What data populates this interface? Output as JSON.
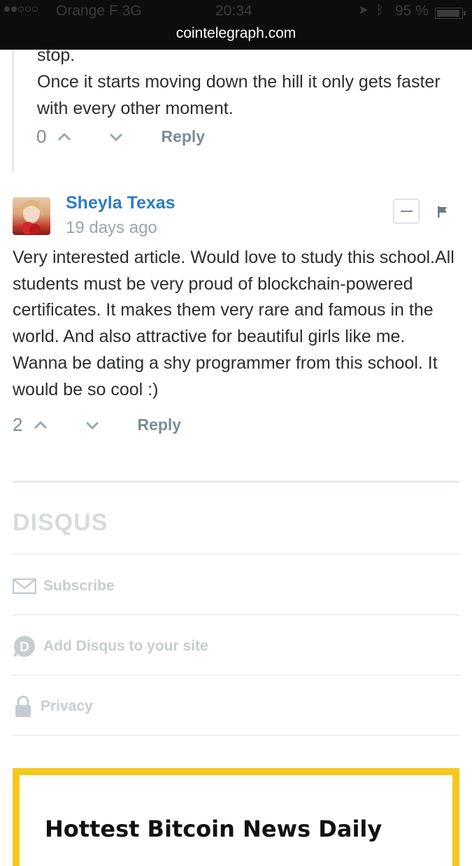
{
  "status_bar": {
    "carrier": "Orange F  3G",
    "time": "20:34",
    "battery": "95 %",
    "battery_level": 0.95
  },
  "browser": {
    "url": "cointelegraph.com"
  },
  "reply": {
    "text_cut": "stop.",
    "text": "Once it starts moving down the hill it only gets faster with every other moment.",
    "votes": "0",
    "reply_label": "Reply"
  },
  "comment": {
    "author": "Sheyla Texas",
    "time_ago": "19 days ago",
    "text": "Very interested article. Would love to study this school.All students must be very proud of blockchain-powered certificates. It makes them very rare and famous in the world. And also attractive for beautiful girls like me. Wanna be dating a shy programmer from this school. It would be so cool :)",
    "votes": "2",
    "reply_label": "Reply"
  },
  "footer": {
    "logo": "DISQUS",
    "subscribe": "Subscribe",
    "add_disqus": "Add Disqus to your site",
    "privacy": "Privacy"
  },
  "newsletter": {
    "title": "Hottest Bitcoin News Daily"
  },
  "colors": {
    "author": "#2e7dc0",
    "muted": "#7c8d96",
    "accent_box": "#f7c81b"
  }
}
